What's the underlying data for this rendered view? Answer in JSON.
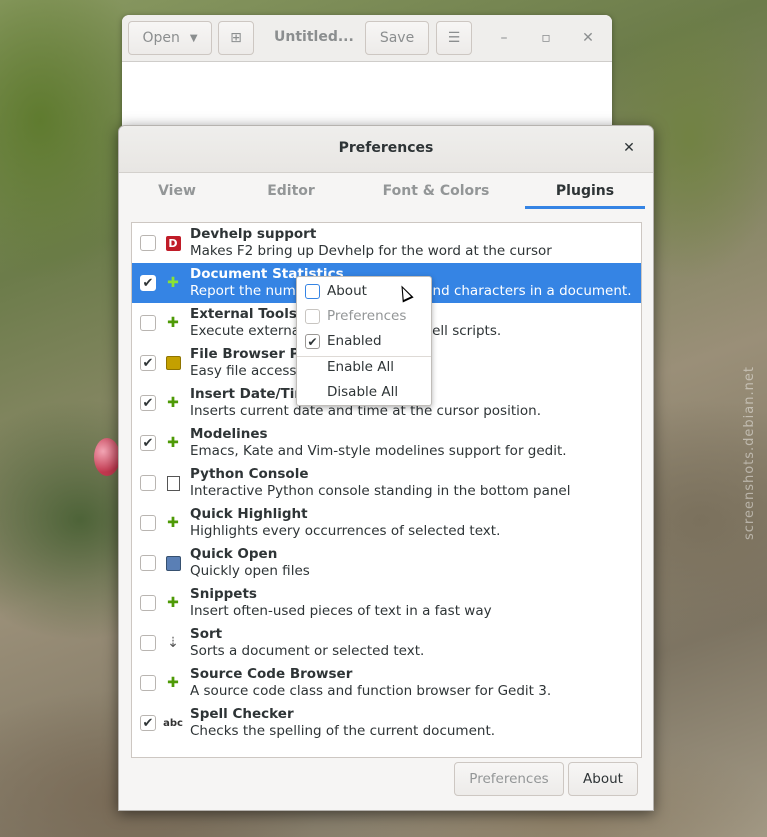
{
  "watermark": "screenshots.debian.net",
  "gedit": {
    "open_label": "Open",
    "title": "Untitled...",
    "save_label": "Save"
  },
  "dialog": {
    "title": "Preferences",
    "tabs": [
      {
        "label": "View",
        "active": false
      },
      {
        "label": "Editor",
        "active": false
      },
      {
        "label": "Font & Colors",
        "active": false
      },
      {
        "label": "Plugins",
        "active": true
      }
    ],
    "plugins": [
      {
        "name": "Devhelp support",
        "description": "Makes F2 bring up Devhelp for the word at the cursor",
        "enabled": false,
        "icon": "devhelp-icon"
      },
      {
        "name": "Document Statistics",
        "description": "Report the number of words, lines and characters in a document.",
        "enabled": true,
        "icon": "puzzle-icon",
        "selected": true
      },
      {
        "name": "External Tools",
        "description": "Execute external commands and shell scripts.",
        "enabled": false,
        "icon": "puzzle-icon"
      },
      {
        "name": "File Browser Panel",
        "description": "Easy file access from the side panel",
        "enabled": true,
        "icon": "folder-icon"
      },
      {
        "name": "Insert Date/Time",
        "description": "Inserts current date and time at the cursor position.",
        "enabled": true,
        "icon": "puzzle-icon"
      },
      {
        "name": "Modelines",
        "description": "Emacs, Kate and Vim-style modelines support for gedit.",
        "enabled": true,
        "icon": "puzzle-icon"
      },
      {
        "name": "Python Console",
        "description": "Interactive Python console standing in the bottom panel",
        "enabled": false,
        "icon": "document-icon"
      },
      {
        "name": "Quick Highlight",
        "description": "Highlights every occurrences of selected text.",
        "enabled": false,
        "icon": "puzzle-icon"
      },
      {
        "name": "Quick Open",
        "description": "Quickly open files",
        "enabled": false,
        "icon": "disk-icon"
      },
      {
        "name": "Snippets",
        "description": "Insert often-used pieces of text in a fast way",
        "enabled": false,
        "icon": "puzzle-icon"
      },
      {
        "name": "Sort",
        "description": "Sorts a document or selected text.",
        "enabled": false,
        "icon": "sort-icon"
      },
      {
        "name": "Source Code Browser",
        "description": "A source code class and function browser for Gedit 3.",
        "enabled": false,
        "icon": "puzzle-icon"
      },
      {
        "name": "Spell Checker",
        "description": "Checks the spelling of the current document.",
        "enabled": true,
        "icon": "spell-check-icon"
      }
    ],
    "preferences_label": "Preferences",
    "about_label": "About"
  },
  "context_menu": {
    "items": [
      {
        "label": "About",
        "checkbox": true,
        "checked": false,
        "disabled": false
      },
      {
        "label": "Preferences",
        "checkbox": true,
        "checked": false,
        "disabled": true
      },
      {
        "label": "Enabled",
        "checkbox": true,
        "checked": true,
        "disabled": false
      },
      {
        "label": "Enable All",
        "checkbox": false
      },
      {
        "label": "Disable All",
        "checkbox": false
      }
    ]
  }
}
